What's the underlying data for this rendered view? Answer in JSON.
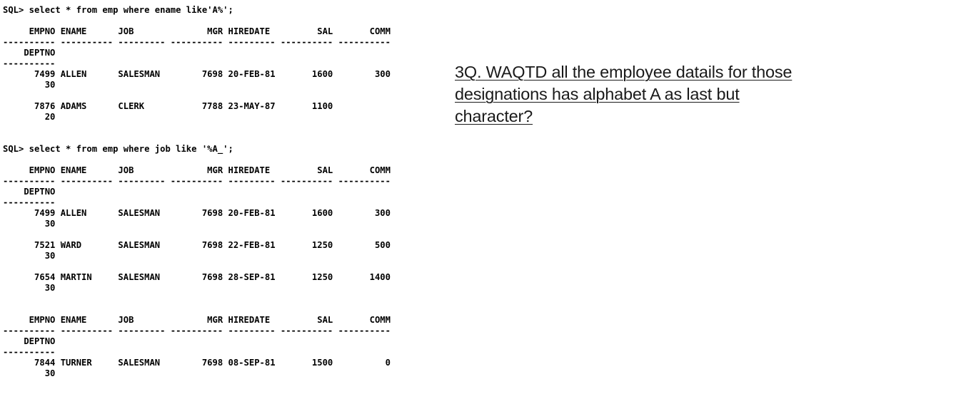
{
  "terminal": {
    "lines": [
      {
        "kind": "sql-prompt",
        "text": "SQL> select * from emp where ename like'A%';"
      },
      {
        "kind": "column-header",
        "text": "     EMPNO ENAME      JOB              MGR HIREDATE         SAL       COMM"
      },
      {
        "kind": "column-underline",
        "text": "---------- ---------- --------- ---------- --------- ---------- ----------"
      },
      {
        "kind": "column-header",
        "text": "    DEPTNO"
      },
      {
        "kind": "column-underline",
        "text": "----------"
      },
      {
        "kind": "result-row",
        "text": "      7499 ALLEN      SALESMAN        7698 20-FEB-81       1600        300"
      },
      {
        "kind": "result-row",
        "text": "        30"
      },
      {
        "kind": "result-row",
        "text": "      7876 ADAMS      CLERK           7788 23-MAY-87       1100"
      },
      {
        "kind": "result-row",
        "text": "        20"
      },
      {
        "kind": "sql-prompt",
        "text": "SQL> select * from emp where job like '%A_';"
      },
      {
        "kind": "column-header",
        "text": "     EMPNO ENAME      JOB              MGR HIREDATE         SAL       COMM"
      },
      {
        "kind": "column-underline",
        "text": "---------- ---------- --------- ---------- --------- ---------- ----------"
      },
      {
        "kind": "column-header",
        "text": "    DEPTNO"
      },
      {
        "kind": "column-underline",
        "text": "----------"
      },
      {
        "kind": "result-row",
        "text": "      7499 ALLEN      SALESMAN        7698 20-FEB-81       1600        300"
      },
      {
        "kind": "result-row",
        "text": "        30"
      },
      {
        "kind": "result-row",
        "text": "      7521 WARD       SALESMAN        7698 22-FEB-81       1250        500"
      },
      {
        "kind": "result-row",
        "text": "        30"
      },
      {
        "kind": "result-row",
        "text": "      7654 MARTIN     SALESMAN        7698 28-SEP-81       1250       1400"
      },
      {
        "kind": "result-row",
        "text": "        30"
      },
      {
        "kind": "column-header",
        "text": "     EMPNO ENAME      JOB              MGR HIREDATE         SAL       COMM"
      },
      {
        "kind": "column-underline",
        "text": "---------- ---------- --------- ---------- --------- ---------- ----------"
      },
      {
        "kind": "column-header",
        "text": "    DEPTNO"
      },
      {
        "kind": "column-underline",
        "text": "----------"
      },
      {
        "kind": "result-row",
        "text": "      7844 TURNER     SALESMAN        7698 08-SEP-81       1500          0"
      },
      {
        "kind": "result-row",
        "text": "        30"
      }
    ]
  },
  "question": {
    "lines": [
      "3Q. WAQTD all the employee datails for those",
      "designations has alphabet A as last but",
      "character?"
    ]
  }
}
